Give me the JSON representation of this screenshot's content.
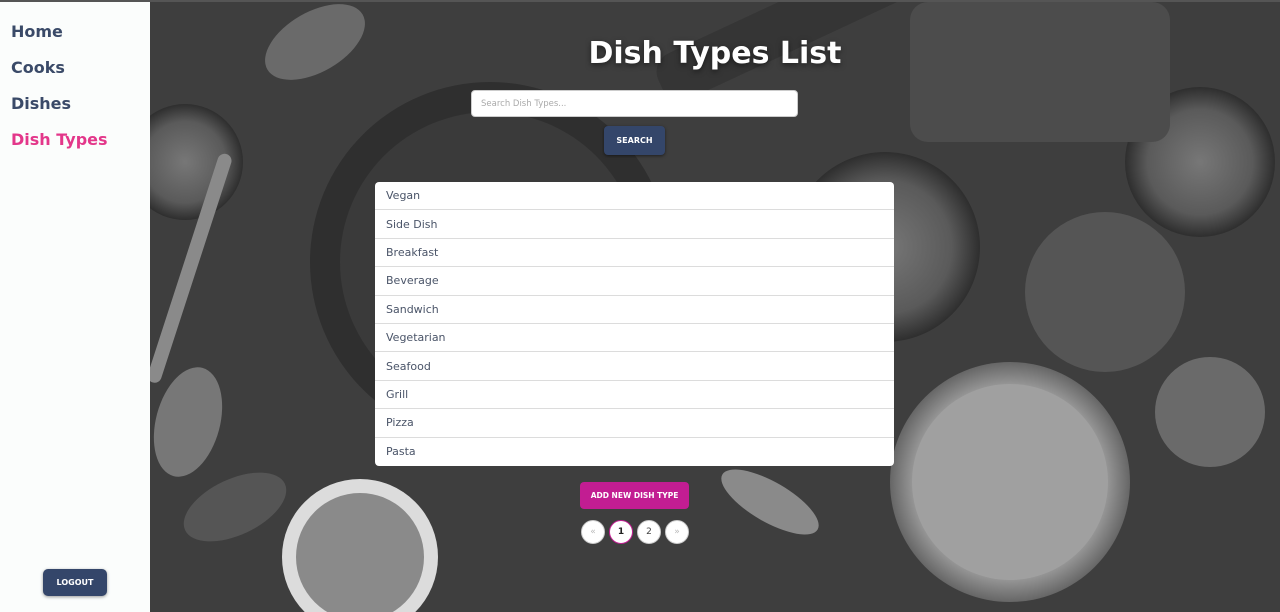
{
  "sidebar": {
    "items": [
      {
        "label": "Home",
        "active": false
      },
      {
        "label": "Cooks",
        "active": false
      },
      {
        "label": "Dishes",
        "active": false
      },
      {
        "label": "Dish Types",
        "active": true
      }
    ],
    "logout_label": "LOGOUT"
  },
  "main": {
    "title": "Dish Types List",
    "search": {
      "placeholder": "Search Dish Types...",
      "value": ""
    },
    "search_button": "SEARCH",
    "dish_types": [
      "Vegan",
      "Side Dish",
      "Breakfast",
      "Beverage",
      "Sandwich",
      "Vegetarian",
      "Seafood",
      "Grill",
      "Pizza",
      "Pasta"
    ],
    "add_button": "ADD NEW DISH TYPE",
    "pagination": {
      "prev": "«",
      "pages": [
        "1",
        "2"
      ],
      "current": "1",
      "next": "»"
    }
  },
  "colors": {
    "sidebar_text": "#3a4a68",
    "sidebar_active": "#e3378a",
    "primary_button": "#34466a",
    "accent_button": "#c21d92"
  }
}
